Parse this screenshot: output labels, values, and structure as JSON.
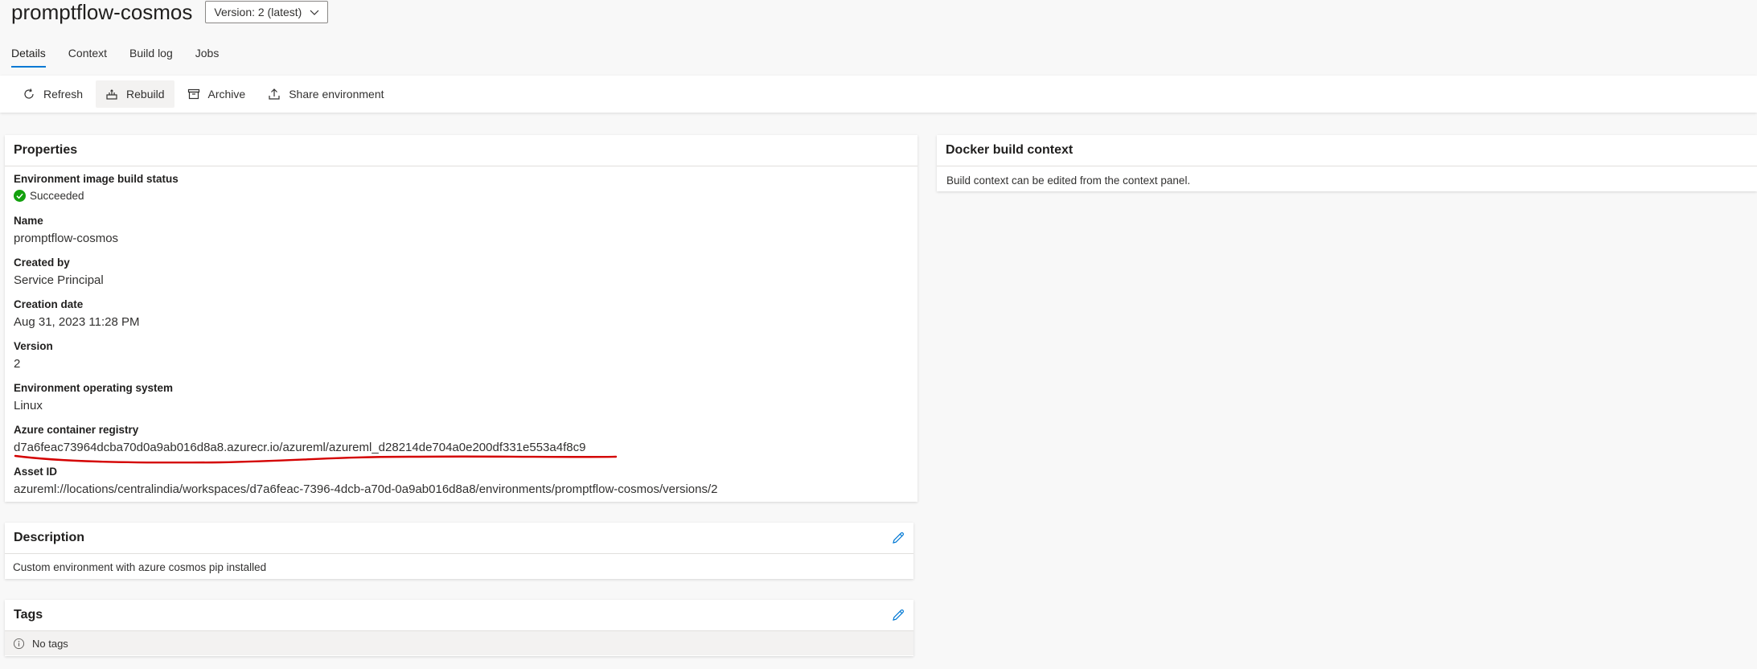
{
  "header": {
    "title": "promptflow-cosmos",
    "version_select": "Version: 2 (latest)"
  },
  "tabs": [
    {
      "label": "Details",
      "active": true
    },
    {
      "label": "Context",
      "active": false
    },
    {
      "label": "Build log",
      "active": false
    },
    {
      "label": "Jobs",
      "active": false
    }
  ],
  "toolbar": {
    "refresh": "Refresh",
    "rebuild": "Rebuild",
    "archive": "Archive",
    "share": "Share environment"
  },
  "properties": {
    "title": "Properties",
    "build_status_label": "Environment image build status",
    "build_status_value": "Succeeded",
    "name_label": "Name",
    "name_value": "promptflow-cosmos",
    "created_by_label": "Created by",
    "created_by_value": "Service Principal",
    "creation_date_label": "Creation date",
    "creation_date_value": "Aug 31, 2023 11:28 PM",
    "version_label": "Version",
    "version_value": "2",
    "os_label": "Environment operating system",
    "os_value": "Linux",
    "registry_label": "Azure container registry",
    "registry_value": "d7a6feac73964dcba70d0a9ab016d8a8.azurecr.io/azureml/azureml_d28214de704a0e200df331e553a4f8c9",
    "asset_id_label": "Asset ID",
    "asset_id_value": "azureml://locations/centralindia/workspaces/d7a6feac-7396-4dcb-a70d-0a9ab016d8a8/environments/promptflow-cosmos/versions/2"
  },
  "docker": {
    "title": "Docker build context",
    "body": "Build context can be edited from the context panel."
  },
  "description": {
    "title": "Description",
    "body": "Custom environment with azure cosmos pip installed"
  },
  "tags": {
    "title": "Tags",
    "body": "No tags"
  },
  "colors": {
    "accent": "#0078d4",
    "success": "#13a10e",
    "annotation": "#d40000"
  }
}
